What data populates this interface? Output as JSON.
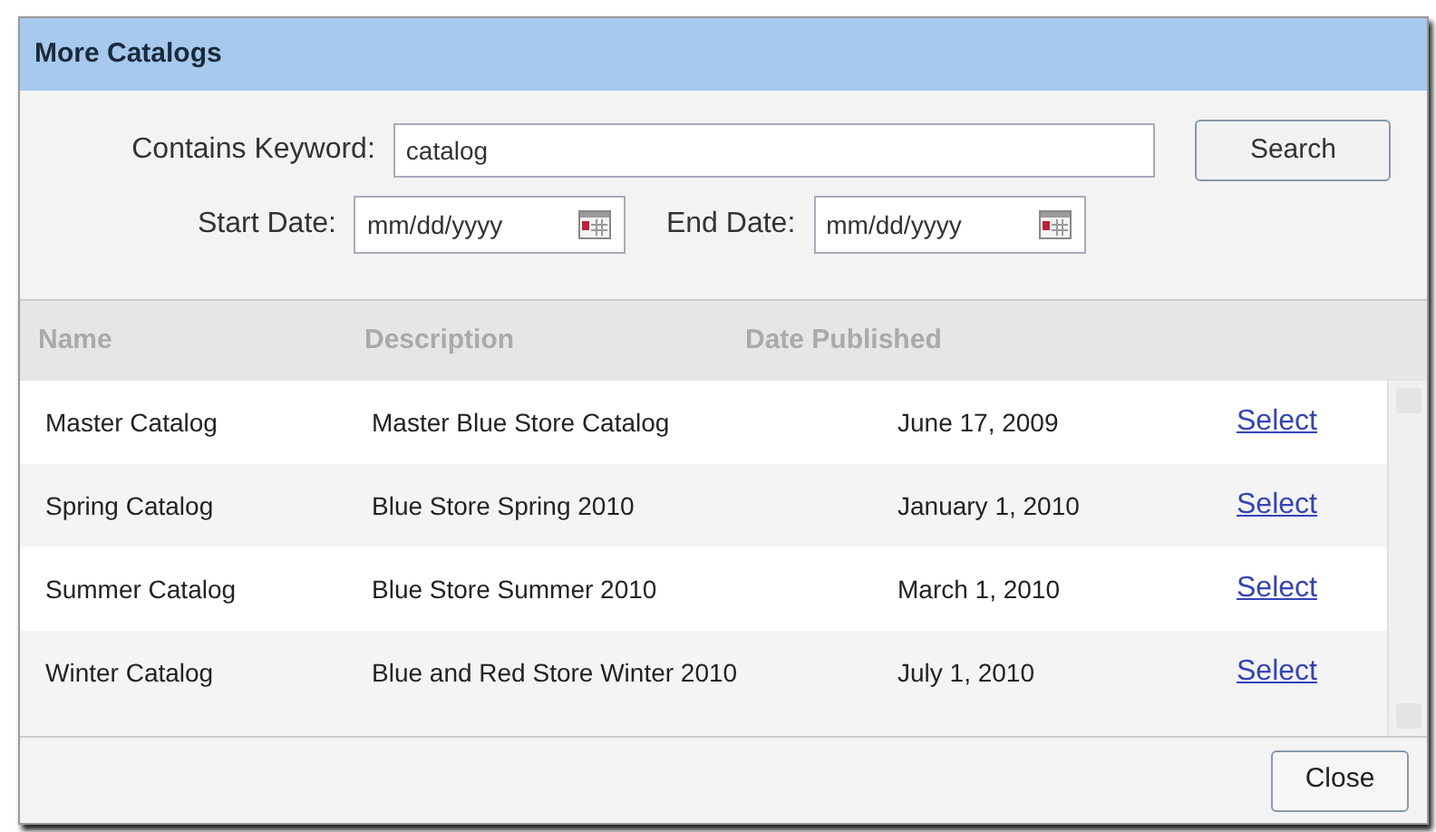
{
  "window": {
    "title": "More Catalogs"
  },
  "form": {
    "keyword": {
      "label": "Contains Keyword:",
      "value": "catalog"
    },
    "search_button": "Search",
    "start_date": {
      "label": "Start Date:",
      "placeholder": "mm/dd/yyyy"
    },
    "end_date": {
      "label": "End Date:",
      "placeholder": "mm/dd/yyyy"
    }
  },
  "table": {
    "columns": [
      "Name",
      "Description",
      "Date Published"
    ],
    "rows": [
      {
        "name": "Master Catalog",
        "description": "Master Blue Store Catalog",
        "date": "June 17, 2009",
        "action": "Select"
      },
      {
        "name": "Spring Catalog",
        "description": "Blue Store Spring 2010",
        "date": "January 1, 2010",
        "action": "Select"
      },
      {
        "name": "Summer Catalog",
        "description": "Blue Store Summer 2010",
        "date": "March 1, 2010",
        "action": "Select"
      },
      {
        "name": "Winter Catalog",
        "description": "Blue and Red Store Winter 2010",
        "date": "July 1, 2010",
        "action": "Select"
      }
    ]
  },
  "footer": {
    "close_button": "Close"
  }
}
